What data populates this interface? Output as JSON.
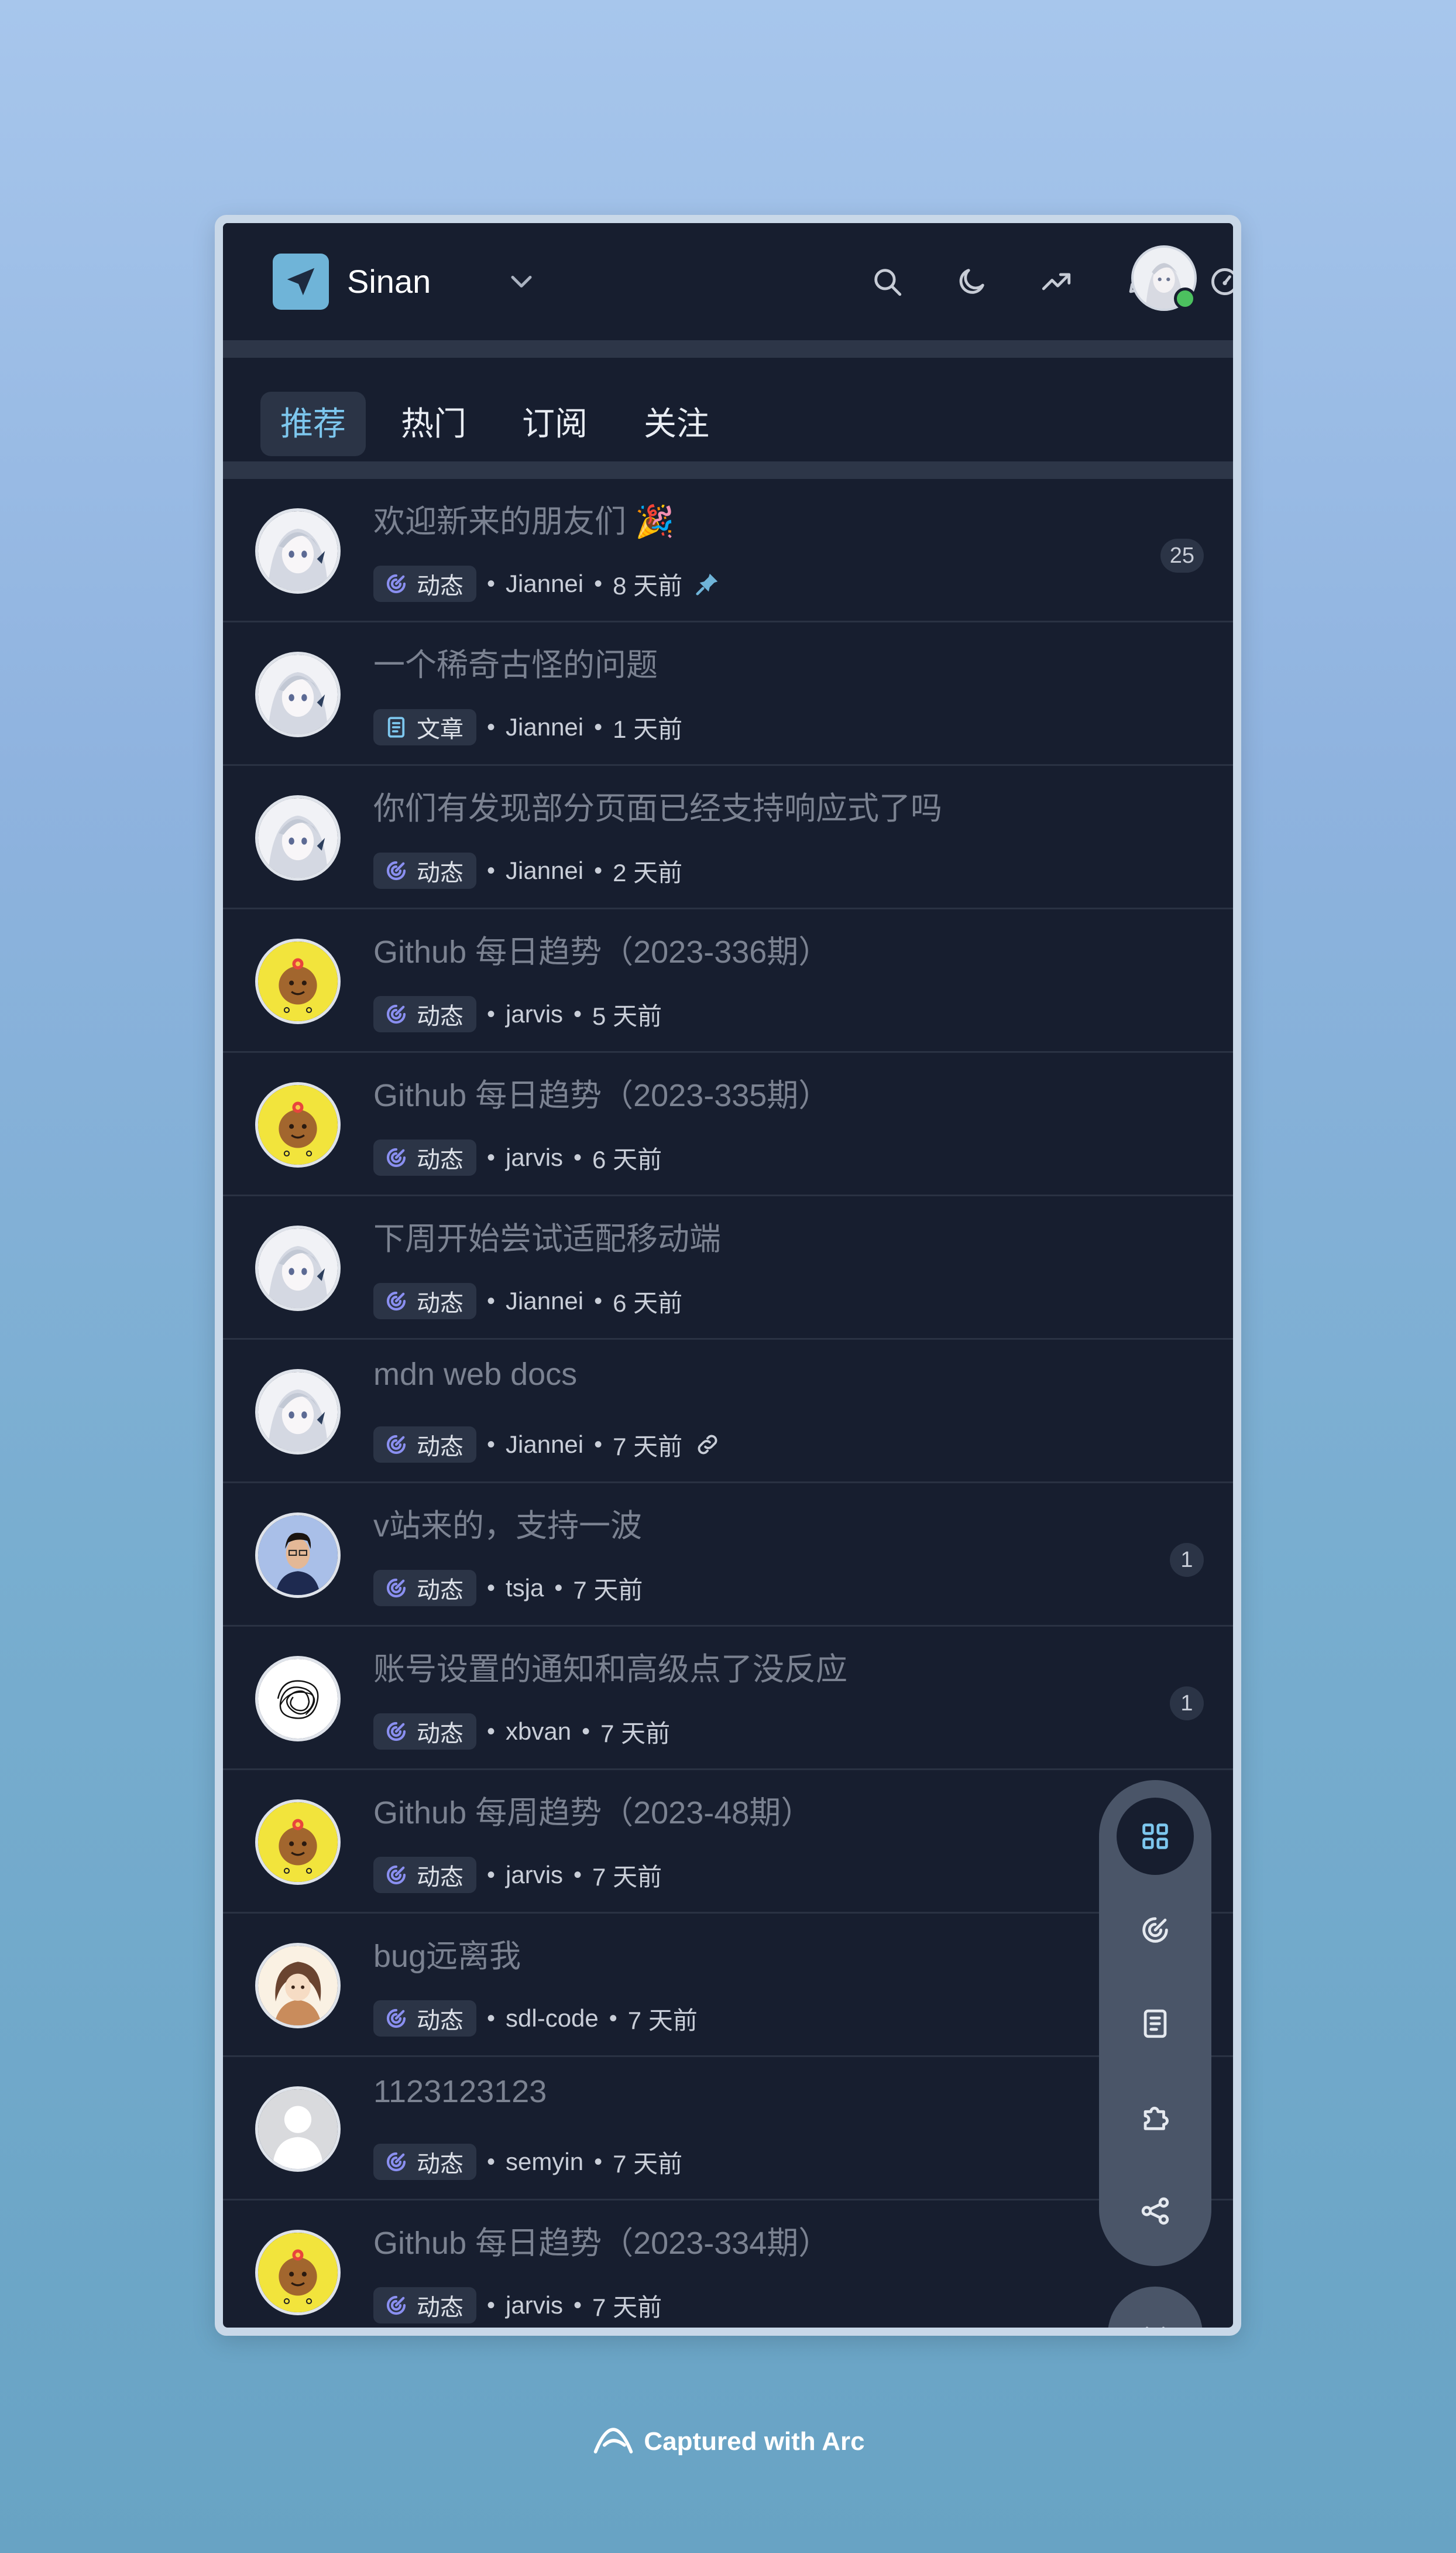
{
  "header": {
    "brand_name": "Sinan",
    "icons": [
      "send-icon",
      "chevron-down-icon",
      "search-icon",
      "moon-icon",
      "trending-icon",
      "pen-icon",
      "gauge-icon",
      "bell-icon"
    ],
    "user_status_color": "#4cc15f"
  },
  "tabs": [
    {
      "label": "推荐",
      "active": true
    },
    {
      "label": "热门",
      "active": false
    },
    {
      "label": "订阅",
      "active": false
    },
    {
      "label": "关注",
      "active": false
    }
  ],
  "feed": [
    {
      "title": "欢迎新来的朋友们 🎉",
      "tag": "动态",
      "tag_icon": "moment-icon",
      "author": "Jiannei",
      "time": "8 天前",
      "extra_icon": "pin-icon",
      "count": "25",
      "avatar": "anime"
    },
    {
      "title": "一个稀奇古怪的问题",
      "tag": "文章",
      "tag_icon": "article-icon",
      "author": "Jiannei",
      "time": "1 天前",
      "avatar": "anime"
    },
    {
      "title": "你们有发现部分页面已经支持响应式了吗",
      "tag": "动态",
      "tag_icon": "moment-icon",
      "author": "Jiannei",
      "time": "2 天前",
      "avatar": "anime"
    },
    {
      "title": "Github 每日趋势（2023-336期）",
      "tag": "动态",
      "tag_icon": "moment-icon",
      "author": "jarvis",
      "time": "5 天前",
      "avatar": "flower"
    },
    {
      "title": "Github 每日趋势（2023-335期）",
      "tag": "动态",
      "tag_icon": "moment-icon",
      "author": "jarvis",
      "time": "6 天前",
      "avatar": "flower"
    },
    {
      "title": "下周开始尝试适配移动端",
      "tag": "动态",
      "tag_icon": "moment-icon",
      "author": "Jiannei",
      "time": "6 天前",
      "avatar": "anime"
    },
    {
      "title": "mdn web docs",
      "tag": "动态",
      "tag_icon": "moment-icon",
      "author": "Jiannei",
      "time": "7 天前",
      "extra_icon": "link-icon",
      "avatar": "anime"
    },
    {
      "title": "v站来的，支持一波",
      "tag": "动态",
      "tag_icon": "moment-icon",
      "author": "tsja",
      "time": "7 天前",
      "count": "1",
      "avatar": "person"
    },
    {
      "title": "账号设置的通知和高级点了没反应",
      "tag": "动态",
      "tag_icon": "moment-icon",
      "author": "xbvan",
      "time": "7 天前",
      "count": "1",
      "avatar": "scribble"
    },
    {
      "title": "Github 每周趋势（2023-48期）",
      "tag": "动态",
      "tag_icon": "moment-icon",
      "author": "jarvis",
      "time": "7 天前",
      "avatar": "flower"
    },
    {
      "title": "bug远离我",
      "tag": "动态",
      "tag_icon": "moment-icon",
      "author": "sdl-code",
      "time": "7 天前",
      "avatar": "girl"
    },
    {
      "title": "1123123123",
      "tag": "动态",
      "tag_icon": "moment-icon",
      "author": "semyin",
      "time": "7 天前",
      "avatar": "default"
    },
    {
      "title": "Github 每日趋势（2023-334期）",
      "tag": "动态",
      "tag_icon": "moment-icon",
      "author": "jarvis",
      "time": "7 天前",
      "avatar": "flower"
    }
  ],
  "fab": {
    "items": [
      "grid-icon",
      "moment-icon",
      "article-icon",
      "puzzle-icon",
      "share-icon"
    ],
    "active": "grid-icon"
  },
  "footer": {
    "text": "Captured with Arc"
  },
  "colors": {
    "accent": "#7dc7ee",
    "background": "#171e2f",
    "tag_icon": "#8a8ff0"
  }
}
